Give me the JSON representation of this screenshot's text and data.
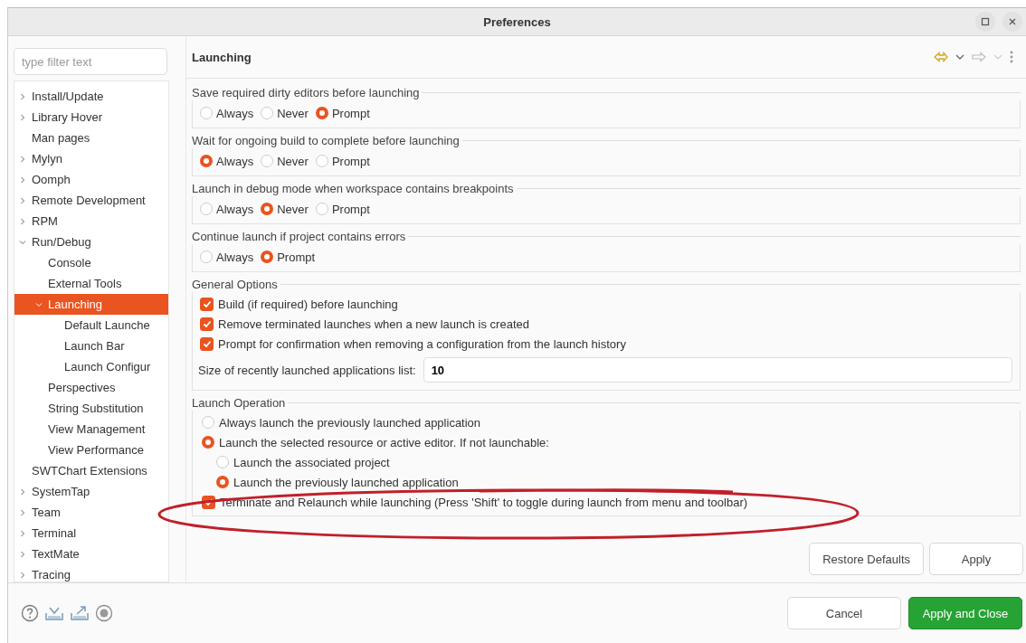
{
  "window": {
    "title": "Preferences"
  },
  "filter": {
    "placeholder": "type filter text"
  },
  "tree": [
    {
      "label": "Install/Update",
      "expanded": false,
      "selected": false
    },
    {
      "label": "Library Hover",
      "expanded": false,
      "selected": false
    },
    {
      "label": "Man pages",
      "selected": false
    },
    {
      "label": "Mylyn",
      "expanded": false,
      "selected": false
    },
    {
      "label": "Oomph",
      "expanded": false,
      "selected": false
    },
    {
      "label": "Remote Development",
      "expanded": false,
      "selected": false
    },
    {
      "label": "RPM",
      "expanded": false,
      "selected": false
    },
    {
      "label": "Run/Debug",
      "expanded": true,
      "selected": false,
      "children": [
        {
          "label": "Console",
          "selected": false
        },
        {
          "label": "External Tools",
          "selected": false
        },
        {
          "label": "Launching",
          "expanded": true,
          "selected": true,
          "children": [
            {
              "label": "Default Launche",
              "selected": false
            },
            {
              "label": "Launch Bar",
              "selected": false
            },
            {
              "label": "Launch Configur",
              "selected": false
            }
          ]
        },
        {
          "label": "Perspectives",
          "selected": false
        },
        {
          "label": "String Substitution",
          "selected": false
        },
        {
          "label": "View Management",
          "selected": false
        },
        {
          "label": "View Performance",
          "selected": false
        }
      ]
    },
    {
      "label": "SWTChart Extensions",
      "selected": false
    },
    {
      "label": "SystemTap",
      "expanded": false,
      "selected": false
    },
    {
      "label": "Team",
      "expanded": false,
      "selected": false
    },
    {
      "label": "Terminal",
      "expanded": false,
      "selected": false
    },
    {
      "label": "TextMate",
      "expanded": false,
      "selected": false
    },
    {
      "label": "Tracing",
      "expanded": false,
      "selected": false
    }
  ],
  "page": {
    "title": "Launching"
  },
  "groups": [
    {
      "kind": "radio",
      "title": "Save required dirty editors before launching",
      "options": [
        {
          "label": "Always",
          "selected": false
        },
        {
          "label": "Never",
          "selected": false
        },
        {
          "label": "Prompt",
          "selected": true
        }
      ]
    },
    {
      "kind": "radio",
      "title": "Wait for ongoing build to complete before launching",
      "options": [
        {
          "label": "Always",
          "selected": true
        },
        {
          "label": "Never",
          "selected": false
        },
        {
          "label": "Prompt",
          "selected": false
        }
      ]
    },
    {
      "kind": "radio",
      "title": "Launch in debug mode when workspace contains breakpoints",
      "options": [
        {
          "label": "Always",
          "selected": false
        },
        {
          "label": "Never",
          "selected": true
        },
        {
          "label": "Prompt",
          "selected": false
        }
      ]
    },
    {
      "kind": "radio",
      "title": "Continue launch if project contains errors",
      "options": [
        {
          "label": "Always",
          "selected": false
        },
        {
          "label": "Prompt",
          "selected": true
        }
      ]
    },
    {
      "kind": "options",
      "title": "General Options",
      "checks": [
        {
          "label": "Build (if required) before launching",
          "checked": true
        },
        {
          "label": "Remove terminated launches when a new launch is created",
          "checked": true
        },
        {
          "label": "Prompt for confirmation when removing a configuration from the launch history",
          "checked": true
        }
      ],
      "field": {
        "label": "Size of recently launched applications list:",
        "value": "10"
      }
    },
    {
      "kind": "operation",
      "title": "Launch Operation",
      "items": [
        {
          "kind": "radio",
          "label": "Always launch the previously launched application",
          "selected": false
        },
        {
          "kind": "radio",
          "label": "Launch the selected resource or active editor. If not launchable:",
          "selected": true,
          "children": [
            {
              "kind": "radio",
              "label": "Launch the associated project",
              "selected": false
            },
            {
              "kind": "radio",
              "label": "Launch the previously launched application",
              "selected": true
            }
          ]
        },
        {
          "kind": "check",
          "label": "Terminate and Relaunch while launching (Press 'Shift' to toggle during launch from menu and toolbar)",
          "checked": true
        }
      ]
    }
  ],
  "page_buttons": [
    "Restore Defaults",
    "Apply"
  ],
  "dialog_buttons": [
    {
      "label": "Cancel",
      "kind": "normal"
    },
    {
      "label": "Apply and Close",
      "kind": "primary"
    }
  ]
}
